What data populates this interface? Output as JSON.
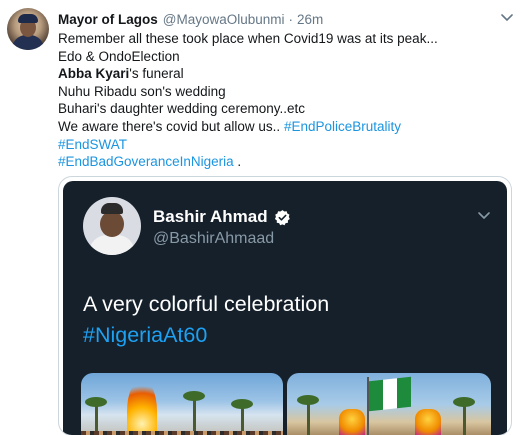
{
  "tweet": {
    "author_name": "Mayor of Lagos",
    "author_handle": "@MayowaOlubunmi",
    "separator": "·",
    "time": "26m",
    "lines": {
      "l1": "Remember all these took place when Covid19 was at its peak...",
      "l2": "Edo & OndoElection",
      "l3_bold": "Abba Kyari",
      "l3_rest": "'s funeral",
      "l4": "Nuhu Ribadu son's wedding",
      "l5": "Buhari's daughter wedding ceremony..etc",
      "l6_text": "We aware there's covid but allow us.. ",
      "l6_tag": "#EndPoliceBrutality",
      "l7_tag": "#EndSWAT",
      "l8_tag": "#EndBadGoveranceInNigeria",
      "l8_rest": " ."
    }
  },
  "quoted": {
    "name": "Bashir Ahmad",
    "handle": "@BashirAhmaad",
    "text": "A very colorful celebration",
    "hashtag": "#NigeriaAt60"
  },
  "icons": {
    "caret": "chevron-down-icon",
    "verified": "verified-badge-icon"
  },
  "colors": {
    "link": "#1b95e0",
    "quoted_bg": "#15202b",
    "quoted_hashtag": "#1da1f2",
    "muted": "#657786"
  }
}
